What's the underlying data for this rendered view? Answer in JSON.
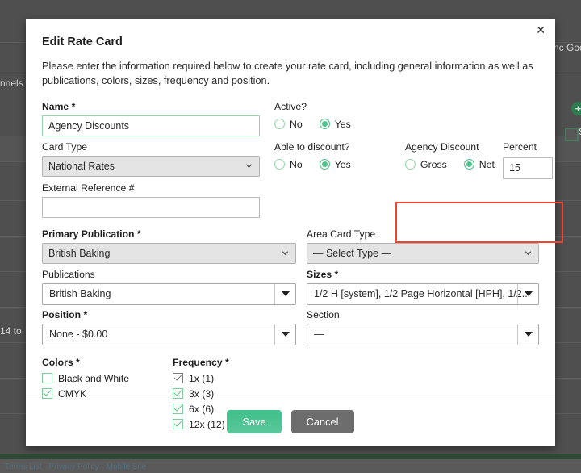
{
  "background": {
    "channels_text": "nnels",
    "sync_text": "nc Goog",
    "count_text": "14 to",
    "sidebar_check_text": "S",
    "plus_icon": "+",
    "footer_links": "Terms List  ·  Privacy Policy  ·  Mobile Site"
  },
  "modal": {
    "title": "Edit Rate Card",
    "close_label": "✕",
    "description": "Please enter the information required below to create your rate card, including general information as well as publications, colors, sizes, frequency and position.",
    "name": {
      "label": "Name *",
      "value": "Agency Discounts",
      "placeholder": ""
    },
    "active": {
      "label": "Active?",
      "options": [
        "No",
        "Yes"
      ],
      "selected": "Yes"
    },
    "card_type": {
      "label": "Card Type",
      "value": "National Rates"
    },
    "able_to_discount": {
      "label": "Able to discount?",
      "options": [
        "No",
        "Yes"
      ],
      "selected": "Yes"
    },
    "agency_discount": {
      "label": "Agency Discount",
      "options": [
        "Gross",
        "Net"
      ],
      "selected": "Net"
    },
    "percent": {
      "label": "Percent",
      "value": "15",
      "placeholder": ""
    },
    "external_reference": {
      "label": "External Reference #",
      "value": "",
      "placeholder": ""
    },
    "primary_publication": {
      "label": "Primary Publication *",
      "value": "British Baking"
    },
    "area_card_type": {
      "label": "Area Card Type",
      "value": "— Select Type —"
    },
    "publications": {
      "label": "Publications",
      "value": "British Baking"
    },
    "sizes": {
      "label": "Sizes *",
      "value": "1/2 H [system], 1/2 Page Horizontal [HPH], 1/2..."
    },
    "position": {
      "label": "Position *",
      "value": "None - $0.00"
    },
    "section": {
      "label": "Section",
      "value": "—"
    },
    "colors": {
      "label": "Colors *",
      "items": [
        {
          "label": "Black and White",
          "checked": false,
          "disabled": false
        },
        {
          "label": "CMYK",
          "checked": true,
          "disabled": false
        }
      ]
    },
    "frequency": {
      "label": "Frequency *",
      "items": [
        {
          "label": "1x (1)",
          "checked": true,
          "disabled": true
        },
        {
          "label": "3x (3)",
          "checked": true,
          "disabled": false
        },
        {
          "label": "6x (6)",
          "checked": true,
          "disabled": false
        },
        {
          "label": "12x (12)",
          "checked": true,
          "disabled": false
        }
      ]
    },
    "save_label": "Save",
    "cancel_label": "Cancel"
  },
  "colors": {
    "accent_green": "#4cc38a",
    "highlight_red": "#f3412c",
    "cancel_grey": "#6d6d6d",
    "overlay": "#4f4f4f"
  }
}
